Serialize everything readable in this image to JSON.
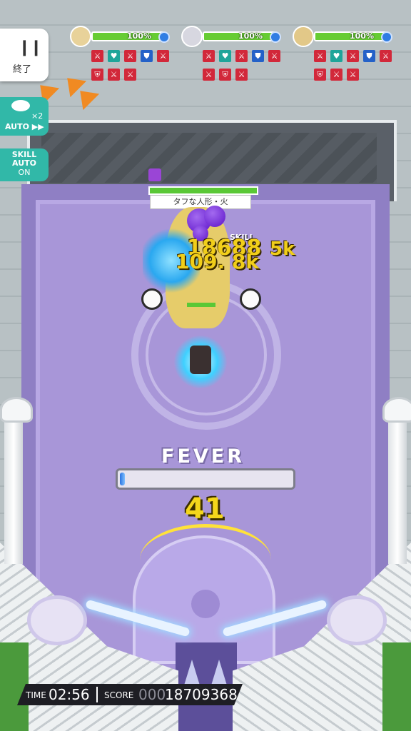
{
  "hud": {
    "pause_label": "終了",
    "auto_multiplier": "×2",
    "auto_label": "AUTO ▶▶",
    "skill_auto_line1": "SKILL",
    "skill_auto_line2": "AUTO",
    "skill_auto_state": "ON"
  },
  "party": [
    {
      "hp_text": "100%",
      "hp_fraction": 1.0,
      "portrait_color": "#e8d29a"
    },
    {
      "hp_text": "100%",
      "hp_fraction": 1.0,
      "portrait_color": "#d7d7e0"
    },
    {
      "hp_text": "100%",
      "hp_fraction": 1.0,
      "portrait_color": "#e2c888"
    }
  ],
  "boss": {
    "name": "タフな人形・火",
    "hp_fraction": 1.0,
    "skill_label": "SKILL"
  },
  "damage": {
    "primary": "18688",
    "secondary": "109. 8k",
    "tertiary": "5k"
  },
  "fever": {
    "label": "FEVER",
    "fraction": 0.03
  },
  "combo": "41",
  "timer": {
    "time_label": "TIME",
    "time_value": "02:56",
    "score_label": "SCORE",
    "score_leading_zeros": "000",
    "score_value": "18709368"
  },
  "colors": {
    "accent_teal": "#31b8a8",
    "hp_green": "#66cc33",
    "damage_yellow": "#f1ce1a",
    "fever_blue": "#2a72e0"
  }
}
